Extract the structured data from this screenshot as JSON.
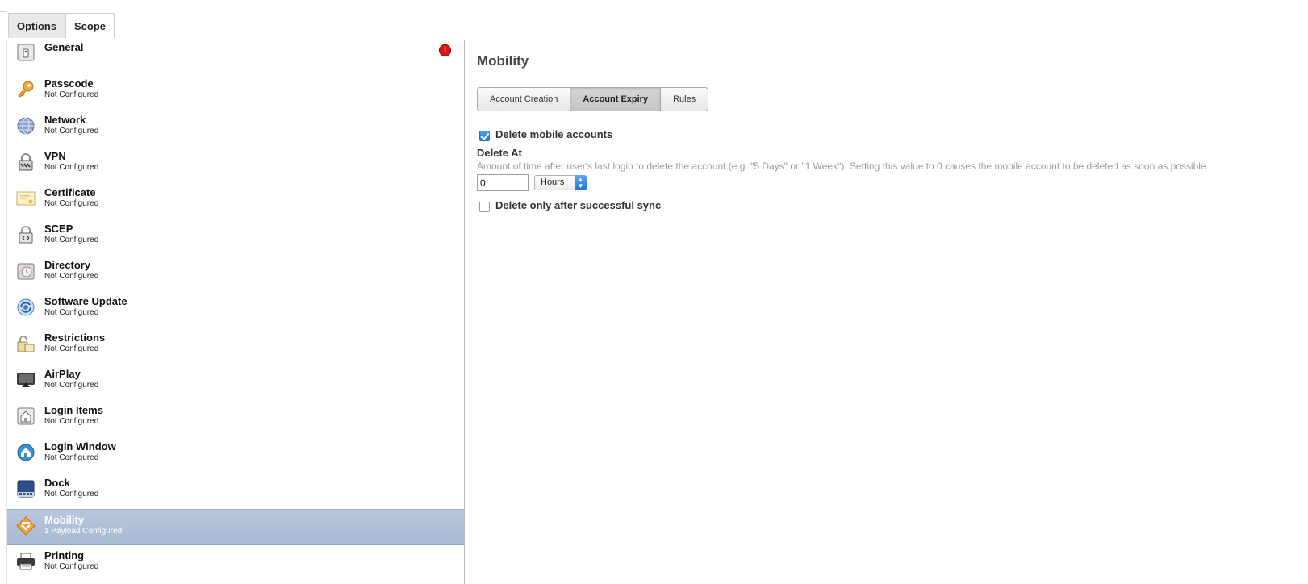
{
  "tabs": [
    "Options",
    "Scope"
  ],
  "sidebar": {
    "items": [
      {
        "name": "General",
        "status": "",
        "icon": "general-icon",
        "alert": true
      },
      {
        "name": "Passcode",
        "status": "Not Configured",
        "icon": "key-icon"
      },
      {
        "name": "Network",
        "status": "Not Configured",
        "icon": "globe-icon"
      },
      {
        "name": "VPN",
        "status": "Not Configured",
        "icon": "vpn-lock-icon"
      },
      {
        "name": "Certificate",
        "status": "Not Configured",
        "icon": "certificate-icon"
      },
      {
        "name": "SCEP",
        "status": "Not Configured",
        "icon": "scep-lock-icon"
      },
      {
        "name": "Directory",
        "status": "Not Configured",
        "icon": "directory-icon"
      },
      {
        "name": "Software Update",
        "status": "Not Configured",
        "icon": "software-update-icon"
      },
      {
        "name": "Restrictions",
        "status": "Not Configured",
        "icon": "restrictions-lock-icon"
      },
      {
        "name": "AirPlay",
        "status": "Not Configured",
        "icon": "airplay-icon"
      },
      {
        "name": "Login Items",
        "status": "Not Configured",
        "icon": "login-items-icon"
      },
      {
        "name": "Login Window",
        "status": "Not Configured",
        "icon": "login-window-icon"
      },
      {
        "name": "Dock",
        "status": "Not Configured",
        "icon": "dock-icon"
      },
      {
        "name": "Mobility",
        "status": "1 Payload Configured",
        "icon": "mobility-icon",
        "selected": true
      },
      {
        "name": "Printing",
        "status": "Not Configured",
        "icon": "printer-icon"
      }
    ],
    "alert_glyph": "!"
  },
  "main": {
    "title": "Mobility",
    "subtabs": [
      "Account Creation",
      "Account Expiry",
      "Rules"
    ],
    "active_subtab": "Account Expiry",
    "delete_mobile_accounts": {
      "label": "Delete mobile accounts",
      "checked": true
    },
    "delete_at": {
      "label": "Delete At",
      "hint": "Amount of time after user's last login to delete the account (e.g. \"5 Days\" or \"1 Week\"). Setting this value to 0 causes the mobile account to be deleted as soon as possible",
      "value": "0",
      "unit": "Hours"
    },
    "delete_after_sync": {
      "label": "Delete only after successful sync",
      "checked": false
    }
  },
  "colors": {
    "selection": "#a7b9d3",
    "checkbox_accent": "#1f78e0",
    "alert": "#d01818"
  }
}
